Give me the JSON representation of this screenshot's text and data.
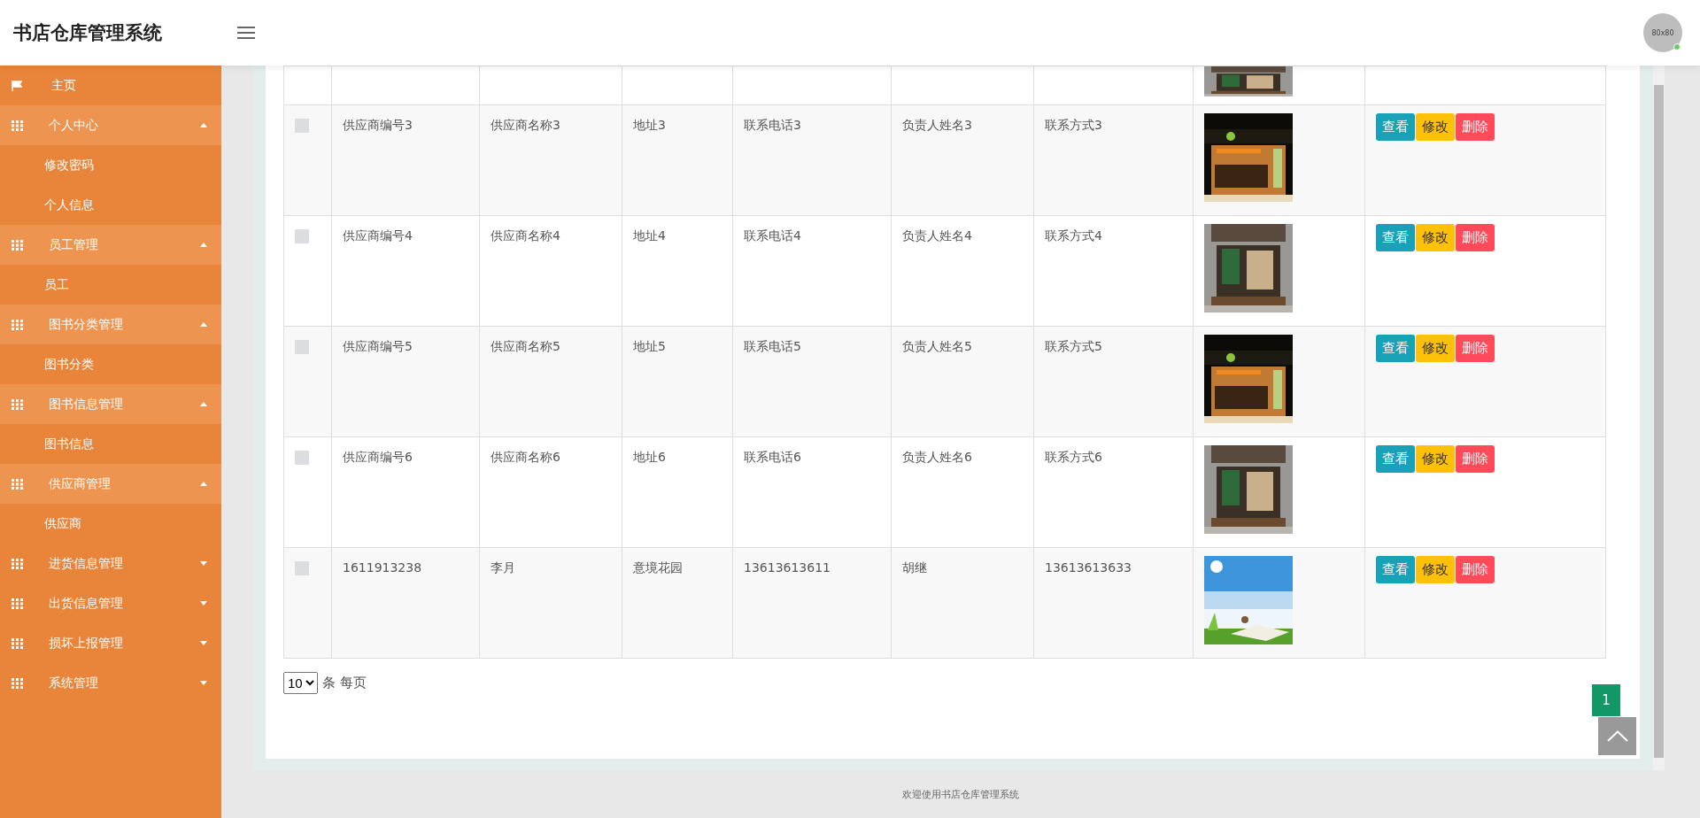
{
  "header": {
    "title": "书店仓库管理系统",
    "avatar_text": "80x80"
  },
  "sidebar": {
    "items": [
      {
        "kind": "home",
        "label": "主页"
      },
      {
        "kind": "group",
        "label": "个人中心",
        "expanded": true
      },
      {
        "kind": "sub",
        "label": "修改密码"
      },
      {
        "kind": "sub",
        "label": "个人信息"
      },
      {
        "kind": "group",
        "label": "员工管理",
        "expanded": true
      },
      {
        "kind": "sub",
        "label": "员工"
      },
      {
        "kind": "group",
        "label": "图书分类管理",
        "expanded": true
      },
      {
        "kind": "sub",
        "label": "图书分类"
      },
      {
        "kind": "group",
        "label": "图书信息管理",
        "expanded": true
      },
      {
        "kind": "sub",
        "label": "图书信息"
      },
      {
        "kind": "group",
        "label": "供应商管理",
        "expanded": true
      },
      {
        "kind": "sub",
        "label": "供应商"
      },
      {
        "kind": "group",
        "label": "进货信息管理",
        "expanded": false
      },
      {
        "kind": "group",
        "label": "出货信息管理",
        "expanded": false
      },
      {
        "kind": "group",
        "label": "损坏上报管理",
        "expanded": false
      },
      {
        "kind": "group",
        "label": "系统管理",
        "expanded": false
      }
    ]
  },
  "table": {
    "rows": [
      {
        "checked": false,
        "cells": [
          "供应商编号3",
          "供应商名称3",
          "地址3",
          "联系电话3",
          "负责人姓名3",
          "联系方式3"
        ],
        "actions": [
          "查看",
          "修改",
          "删除"
        ]
      },
      {
        "checked": false,
        "cells": [
          "供应商编号4",
          "供应商名称4",
          "地址4",
          "联系电话4",
          "负责人姓名4",
          "联系方式4"
        ],
        "actions": [
          "查看",
          "修改",
          "删除"
        ]
      },
      {
        "checked": false,
        "cells": [
          "供应商编号5",
          "供应商名称5",
          "地址5",
          "联系电话5",
          "负责人姓名5",
          "联系方式5"
        ],
        "actions": [
          "查看",
          "修改",
          "删除"
        ]
      },
      {
        "checked": false,
        "cells": [
          "供应商编号6",
          "供应商名称6",
          "地址6",
          "联系电话6",
          "负责人姓名6",
          "联系方式6"
        ],
        "actions": [
          "查看",
          "修改",
          "删除"
        ]
      },
      {
        "checked": false,
        "cells": [
          "1611913238",
          "李月",
          "意境花园",
          "13613613611",
          "胡继",
          "13613613633"
        ],
        "actions": [
          "查看",
          "修改",
          "删除"
        ]
      }
    ]
  },
  "pagination": {
    "page_size": "10",
    "page_size_label": "条 每页",
    "pages": [
      {
        "label": "1",
        "selected": true
      }
    ]
  },
  "footer": "欢迎使用书店仓库管理系统"
}
